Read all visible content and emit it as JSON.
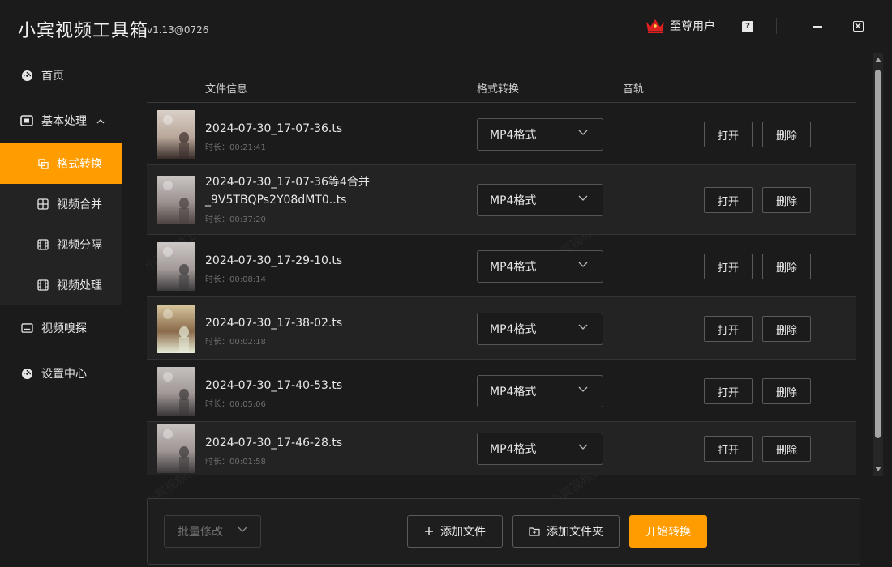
{
  "app": {
    "title": "小宾视频工具箱",
    "version": "v1.13@0726",
    "vip_label": "至尊用户",
    "help_label": "?",
    "accent_color": "#ff9c00"
  },
  "sidebar": {
    "home": "首页",
    "basic": "基本处理",
    "sub": [
      "格式转换",
      "视频合并",
      "视频分隔",
      "视频处理"
    ],
    "sniff": "视频嗅探",
    "settings": "设置中心"
  },
  "table": {
    "headers": {
      "info": "文件信息",
      "convert": "格式转换",
      "track": "音轨"
    },
    "rows": [
      {
        "name": "2024-07-30_17-07-36.ts",
        "name2": "",
        "duration": "时长：00:21:41",
        "format": "MP4格式",
        "open": "打开",
        "delete": "删除"
      },
      {
        "name": "2024-07-30_17-07-36等4合并",
        "name2": "_9V5TBQPs2Y08dMT0..ts",
        "duration": "时长：00:37:20",
        "format": "MP4格式",
        "open": "打开",
        "delete": "删除"
      },
      {
        "name": "2024-07-30_17-29-10.ts",
        "name2": "",
        "duration": "时长：00:08:14",
        "format": "MP4格式",
        "open": "打开",
        "delete": "删除"
      },
      {
        "name": "2024-07-30_17-38-02.ts",
        "name2": "",
        "duration": "时长：00:02:18",
        "format": "MP4格式",
        "open": "打开",
        "delete": "删除"
      },
      {
        "name": "2024-07-30_17-40-53.ts",
        "name2": "",
        "duration": "时长：00:05:06",
        "format": "MP4格式",
        "open": "打开",
        "delete": "删除"
      },
      {
        "name": "2024-07-30_17-46-28.ts",
        "name2": "",
        "duration": "时长：00:01:58",
        "format": "MP4格式",
        "open": "打开",
        "delete": "删除"
      }
    ]
  },
  "bottom": {
    "batch_placeholder": "批量修改",
    "add_file": "添加文件",
    "add_folder": "添加文件夹",
    "start": "开始转换"
  },
  "watermark": "小宾视频工具箱"
}
